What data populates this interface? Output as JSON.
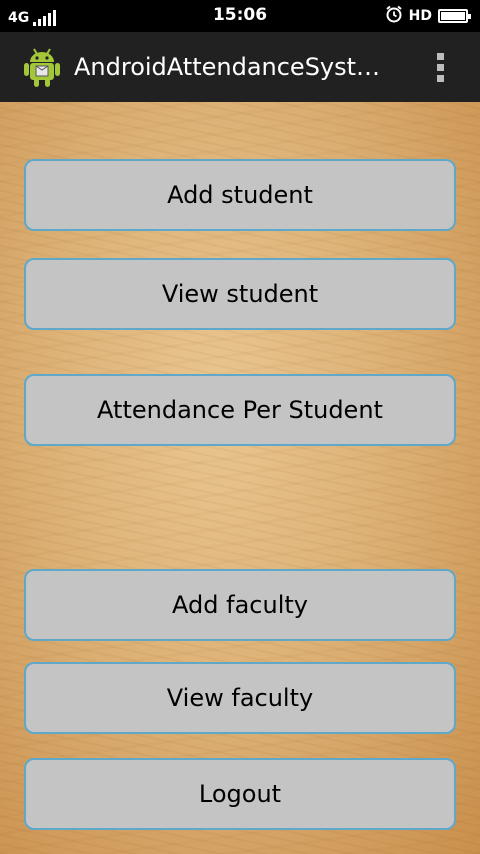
{
  "status_bar": {
    "network": "4G",
    "time": "15:06",
    "hd": "HD",
    "icons": [
      "signal-icon",
      "alarm-icon",
      "battery-icon"
    ]
  },
  "app_bar": {
    "title": "AndroidAttendanceSystem",
    "app_icon": "android-icon",
    "menu_icon": "overflow-menu-icon"
  },
  "menu": {
    "add_student": "Add student",
    "view_student": "View student",
    "attendance_per_student": "Attendance Per Student",
    "add_faculty": "Add faculty",
    "view_faculty": "View faculty",
    "logout": "Logout"
  },
  "colors": {
    "button_bg": "#c4c4c4",
    "button_border": "#5fa8c9",
    "app_bar_bg": "#212121",
    "status_bar_bg": "#000000"
  }
}
